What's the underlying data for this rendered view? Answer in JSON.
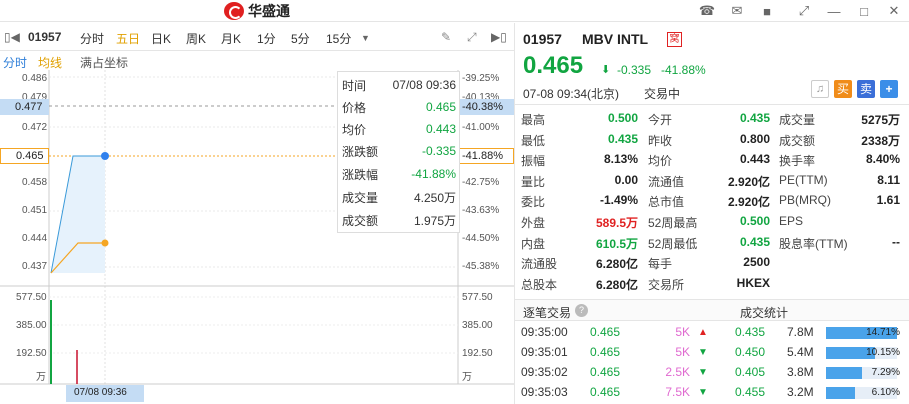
{
  "app": {
    "brand": "华盛通"
  },
  "toolbar": {
    "code": "01957",
    "tabs": [
      "分时",
      "五日",
      "日K",
      "周K",
      "月K",
      "1分",
      "5分",
      "15分"
    ],
    "active_tab": "五日"
  },
  "subtabs": {
    "items": [
      "分时",
      "均线",
      "满占坐标"
    ]
  },
  "chart": {
    "price_ticks": [
      "0.486",
      "0.479",
      "0.477",
      "0.472",
      "0.465",
      "0.458",
      "0.451",
      "0.444",
      "0.437"
    ],
    "pct_ticks": [
      "-39.25%",
      "-40.13%",
      "-40.38%",
      "-41.00%",
      "-41.88%",
      "-42.75%",
      "-43.63%",
      "-44.50%",
      "-45.38%"
    ],
    "vol_ticks_left": [
      "577.50",
      "385.00",
      "192.50",
      "万"
    ],
    "vol_ticks_right": [
      "577.50",
      "385.00",
      "192.50",
      "万"
    ],
    "crosshair_price": "0.477",
    "crosshair_pct": "-40.38%",
    "current_price_label": "0.465",
    "current_pct_label": "-41.88%",
    "date_label": "07/08 09:36",
    "colors": {
      "price_line": "#3a9ad9",
      "avg_line": "#f5a623",
      "dot": "#2f80ed"
    }
  },
  "tooltip": {
    "rows": [
      {
        "k": "时间",
        "v": "07/08 09:36"
      },
      {
        "k": "价格",
        "v": "0.465"
      },
      {
        "k": "均价",
        "v": "0.443"
      },
      {
        "k": "涨跌额",
        "v": "-0.335"
      },
      {
        "k": "涨跌幅",
        "v": "-41.88%"
      },
      {
        "k": "成交量",
        "v": "4.250万"
      },
      {
        "k": "成交额",
        "v": "1.975万"
      }
    ]
  },
  "quote": {
    "code": "01957",
    "name": "MBV INTL",
    "tag": "窝",
    "price": "0.465",
    "change": "-0.335",
    "change_pct": "-41.88%",
    "time": "07-08 09:34(北京)",
    "status": "交易中",
    "buy_label": "买",
    "sell_label": "卖",
    "add_label": "+"
  },
  "stats": [
    [
      {
        "k": "最高",
        "v": "0.500",
        "c": "green"
      },
      {
        "k": "今开",
        "v": "0.435",
        "c": "green"
      },
      {
        "k": "成交量",
        "v": "5275万",
        "c": "dark"
      }
    ],
    [
      {
        "k": "最低",
        "v": "0.435",
        "c": "green"
      },
      {
        "k": "昨收",
        "v": "0.800",
        "c": "dark"
      },
      {
        "k": "成交额",
        "v": "2338万",
        "c": "dark"
      }
    ],
    [
      {
        "k": "振幅",
        "v": "8.13%",
        "c": "dark"
      },
      {
        "k": "均价",
        "v": "0.443",
        "c": "dark"
      },
      {
        "k": "换手率",
        "v": "8.40%",
        "c": "dark"
      }
    ],
    [
      {
        "k": "量比",
        "v": "0.00",
        "c": "dark"
      },
      {
        "k": "流通值",
        "v": "2.920亿",
        "c": "dark"
      },
      {
        "k": "PE(TTM)",
        "v": "8.11",
        "c": "dark"
      }
    ],
    [
      {
        "k": "委比",
        "v": "-1.49%",
        "c": "dark"
      },
      {
        "k": "总市值",
        "v": "2.920亿",
        "c": "dark"
      },
      {
        "k": "PB(MRQ)",
        "v": "1.61",
        "c": "dark"
      }
    ],
    [
      {
        "k": "外盘",
        "v": "589.5万",
        "c": "red"
      },
      {
        "k": "52周最高",
        "v": "0.500",
        "c": "green"
      },
      {
        "k": "EPS",
        "v": "",
        "c": "dark"
      }
    ],
    [
      {
        "k": "内盘",
        "v": "610.5万",
        "c": "green"
      },
      {
        "k": "52周最低",
        "v": "0.435",
        "c": "green"
      },
      {
        "k": "股息率(TTM)",
        "v": "--",
        "c": "dark"
      }
    ],
    [
      {
        "k": "流通股",
        "v": "6.280亿",
        "c": "dark"
      },
      {
        "k": "每手",
        "v": "2500",
        "c": "dark"
      },
      {
        "k": "",
        "v": "",
        "c": "dark"
      }
    ],
    [
      {
        "k": "总股本",
        "v": "6.280亿",
        "c": "dark"
      },
      {
        "k": "交易所",
        "v": "HKEX",
        "c": "dark"
      },
      {
        "k": "",
        "v": "",
        "c": "dark"
      }
    ]
  ],
  "ticks_tab": {
    "left": "逐笔交易",
    "right": "成交统计"
  },
  "trades": [
    {
      "time": "09:35:00",
      "price": "0.465",
      "vol": "5K",
      "dir": "up"
    },
    {
      "time": "09:35:01",
      "price": "0.465",
      "vol": "5K",
      "dir": "down"
    },
    {
      "time": "09:35:02",
      "price": "0.465",
      "vol": "2.5K",
      "dir": "down"
    },
    {
      "time": "09:35:03",
      "price": "0.465",
      "vol": "7.5K",
      "dir": "down"
    }
  ],
  "dist": [
    {
      "price": "0.435",
      "vol": "7.8M",
      "pct": "14.71%",
      "frac": 1.0
    },
    {
      "price": "0.450",
      "vol": "5.4M",
      "pct": "10.15%",
      "frac": 0.69
    },
    {
      "price": "0.405",
      "vol": "3.8M",
      "pct": "7.29%",
      "frac": 0.5
    },
    {
      "price": "0.455",
      "vol": "3.2M",
      "pct": "6.10%",
      "frac": 0.41
    }
  ]
}
